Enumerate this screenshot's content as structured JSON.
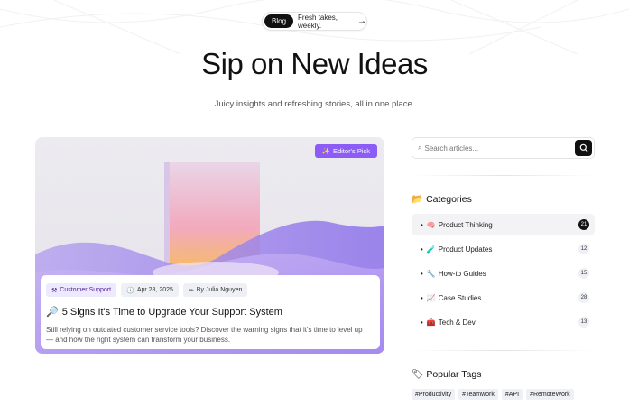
{
  "announcement": {
    "badge": "Blog",
    "text": "Fresh takes, weekly.",
    "arrow": "→"
  },
  "hero": {
    "title": "Sip on New Ideas",
    "subtitle": "Juicy insights and refreshing stories, all in one place."
  },
  "featured": {
    "badge_icon": "✨",
    "badge_label": "Editor's Pick",
    "category_icon": "⚒",
    "category": "Customer Support",
    "date_icon": "🕓",
    "date": "Apr 28, 2025",
    "author_icon": "✏",
    "author": "By Julia Nguyen",
    "title_icon": "🔎",
    "title": "5 Signs It's Time to Upgrade Your Support System",
    "description": "Still relying on outdated customer service tools? Discover the warning signs that it's time to level up — and how the right system can transform your business."
  },
  "search": {
    "placeholder": "Search articles..."
  },
  "categories": {
    "icon": "📂",
    "title": "Categories",
    "items": [
      {
        "icon": "🧠",
        "label": "Product Thinking",
        "count": "21"
      },
      {
        "icon": "🧪",
        "label": "Product Updates",
        "count": "12"
      },
      {
        "icon": "🔧",
        "label": "How-to Guides",
        "count": "15"
      },
      {
        "icon": "📈",
        "label": "Case Studies",
        "count": "28"
      },
      {
        "icon": "🧰",
        "label": "Tech & Dev",
        "count": "13"
      }
    ]
  },
  "tags": {
    "icon": "🏷",
    "title": "Popular Tags",
    "items": [
      "#Productivity",
      "#Teamwork",
      "#API",
      "#RemoteWork"
    ]
  },
  "colors": {
    "accent": "#8b5cf6",
    "dark": "#111111"
  }
}
